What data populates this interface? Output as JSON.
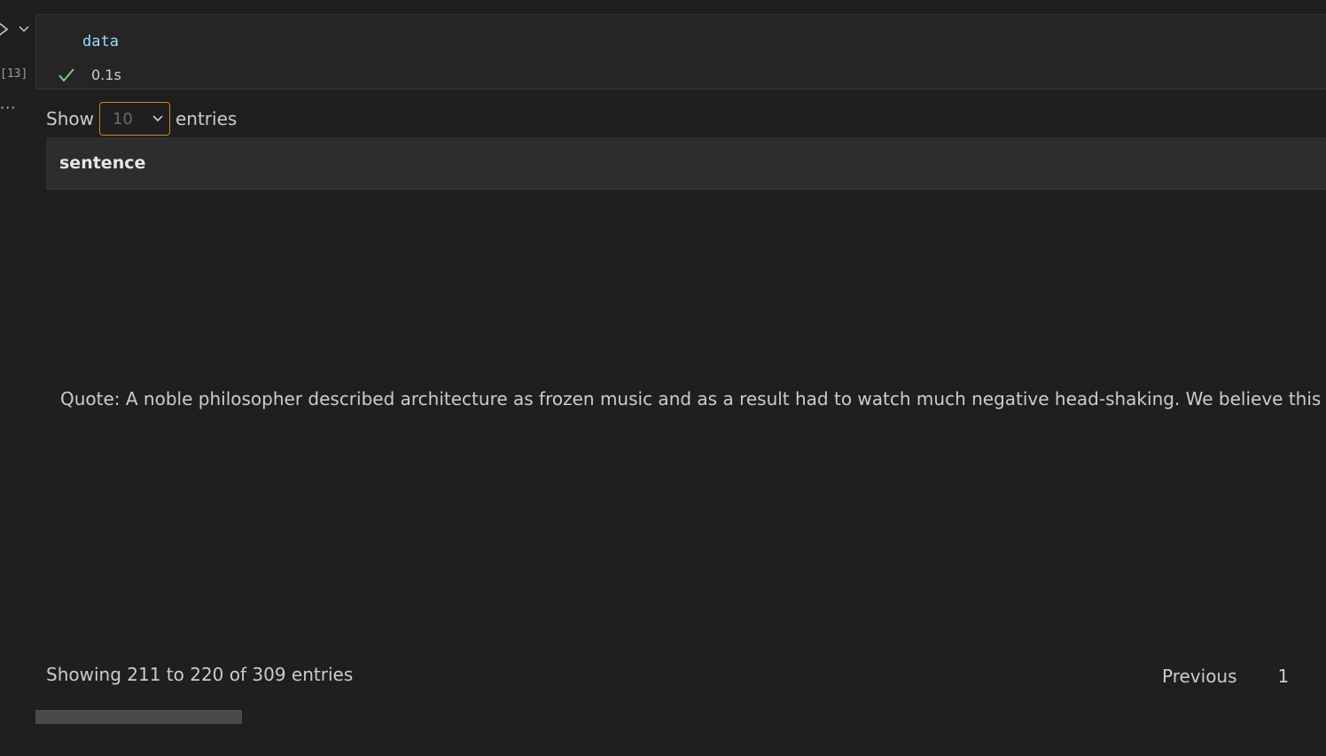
{
  "cell": {
    "code": "data",
    "execution_count": "[13]",
    "status_time": "0.1s",
    "more_label": "···"
  },
  "output": {
    "length": {
      "show_label": "Show",
      "entries_label": "entries",
      "selected": "10"
    },
    "table": {
      "columns": [
        "sentence"
      ],
      "rows": [
        "",
        "",
        "",
        "",
        "Quote: A noble philosopher described architecture as frozen music and as a result had to watch much negative head-shaking. We believe this beautiful ide",
        "",
        "",
        "",
        "",
        ""
      ]
    },
    "info": "Showing 211 to 220 of 309 entries",
    "pagination": {
      "previous": "Previous",
      "page": "1",
      "ellipsis": "…"
    }
  },
  "colors": {
    "background": "#1f1f1f",
    "cell_background": "#252526",
    "code_variable": "#9cdcfe",
    "success_check": "#89d185",
    "focus_border": "#d18616"
  },
  "icons": [
    "run-chevron-icon",
    "collapse-chevron-icon",
    "check-icon",
    "dropdown-chevron-icon"
  ]
}
